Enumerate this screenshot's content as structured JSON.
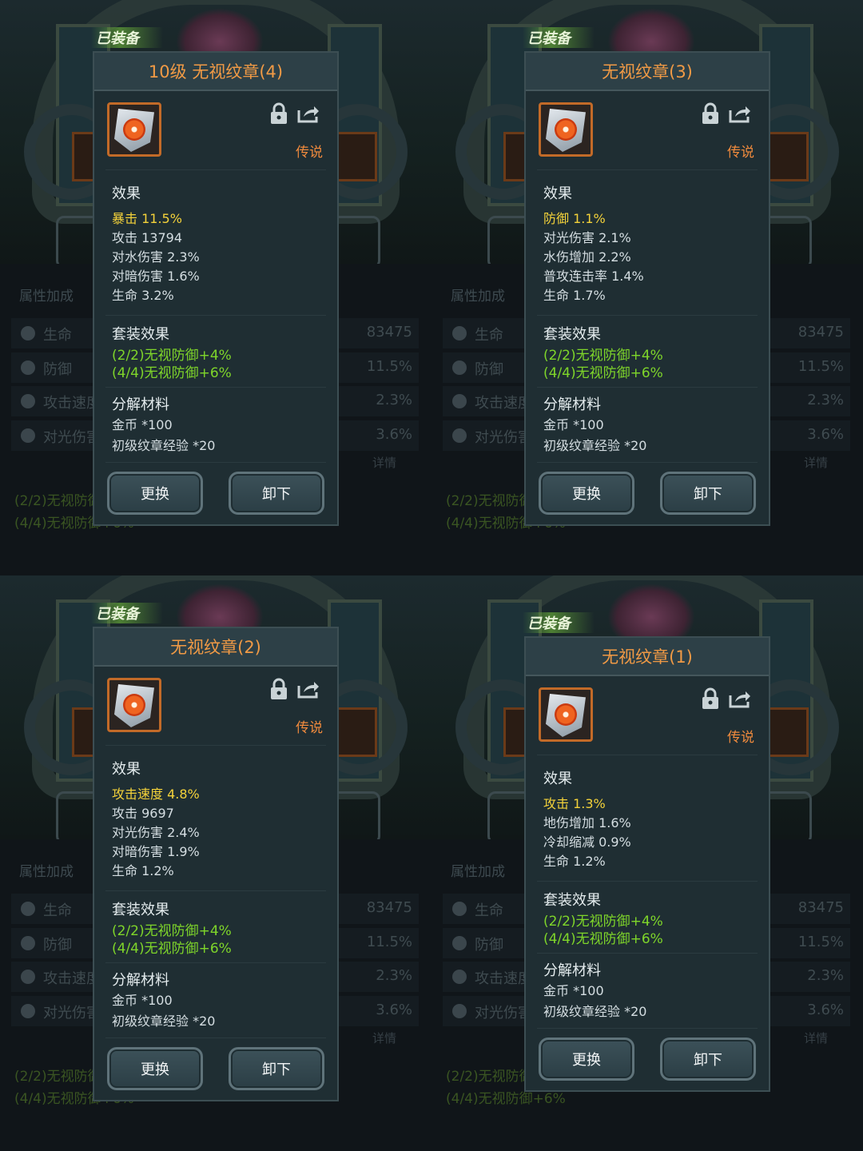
{
  "equipped_label": "已装备",
  "background": {
    "attr_title": "属性加成",
    "attr_rows": [
      {
        "name": "生命",
        "value": "83475"
      },
      {
        "name": "防御",
        "value": "11.5%"
      },
      {
        "name": "攻击速度",
        "value": "2.3%"
      },
      {
        "name": "对光伤害",
        "value": "3.6%"
      }
    ],
    "detail_label": "详情",
    "set_lines": [
      "(2/2)无视防御+4%",
      "(4/4)无视防御+6%"
    ]
  },
  "cards": [
    {
      "title": "10级 无视纹章(4)",
      "rarity": "传说",
      "effects_title": "效果",
      "effects": [
        {
          "name": "暴击",
          "value": "11.5%",
          "highlight": true
        },
        {
          "name": "攻击",
          "value": "13794"
        },
        {
          "name": "对水伤害",
          "value": "2.3%"
        },
        {
          "name": "对暗伤害",
          "value": "1.6%"
        },
        {
          "name": "生命",
          "value": "3.2%"
        }
      ],
      "set_title": "套装效果",
      "set_effects": [
        "(2/2)无视防御+4%",
        "(4/4)无视防御+6%"
      ],
      "materials_title": "分解材料",
      "materials": [
        "金币 *100",
        "初级纹章经验 *20"
      ],
      "replace_label": "更换",
      "unequip_label": "卸下"
    },
    {
      "title": "无视纹章(3)",
      "rarity": "传说",
      "effects_title": "效果",
      "effects": [
        {
          "name": "防御",
          "value": "1.1%",
          "highlight": true
        },
        {
          "name": "对光伤害",
          "value": "2.1%"
        },
        {
          "name": "水伤增加",
          "value": "2.2%"
        },
        {
          "name": "普攻连击率",
          "value": "1.4%"
        },
        {
          "name": "生命",
          "value": "1.7%"
        }
      ],
      "set_title": "套装效果",
      "set_effects": [
        "(2/2)无视防御+4%",
        "(4/4)无视防御+6%"
      ],
      "materials_title": "分解材料",
      "materials": [
        "金币 *100",
        "初级纹章经验 *20"
      ],
      "replace_label": "更换",
      "unequip_label": "卸下"
    },
    {
      "title": "无视纹章(2)",
      "rarity": "传说",
      "effects_title": "效果",
      "effects": [
        {
          "name": "攻击速度",
          "value": "4.8%",
          "highlight": true
        },
        {
          "name": "攻击",
          "value": "9697"
        },
        {
          "name": "对光伤害",
          "value": "2.4%"
        },
        {
          "name": "对暗伤害",
          "value": "1.9%"
        },
        {
          "name": "生命",
          "value": "1.2%"
        }
      ],
      "set_title": "套装效果",
      "set_effects": [
        "(2/2)无视防御+4%",
        "(4/4)无视防御+6%"
      ],
      "materials_title": "分解材料",
      "materials": [
        "金币 *100",
        "初级纹章经验 *20"
      ],
      "replace_label": "更换",
      "unequip_label": "卸下"
    },
    {
      "title": "无视纹章(1)",
      "rarity": "传说",
      "effects_title": "效果",
      "effects": [
        {
          "name": "攻击",
          "value": "1.3%",
          "highlight": true
        },
        {
          "name": "地伤增加",
          "value": "1.6%"
        },
        {
          "name": "冷却缩减",
          "value": "0.9%"
        },
        {
          "name": "生命",
          "value": "1.2%"
        }
      ],
      "set_title": "套装效果",
      "set_effects": [
        "(2/2)无视防御+4%",
        "(4/4)无视防御+6%"
      ],
      "materials_title": "分解材料",
      "materials": [
        "金币 *100",
        "初级纹章经验 *20"
      ],
      "replace_label": "更换",
      "unequip_label": "卸下"
    }
  ]
}
